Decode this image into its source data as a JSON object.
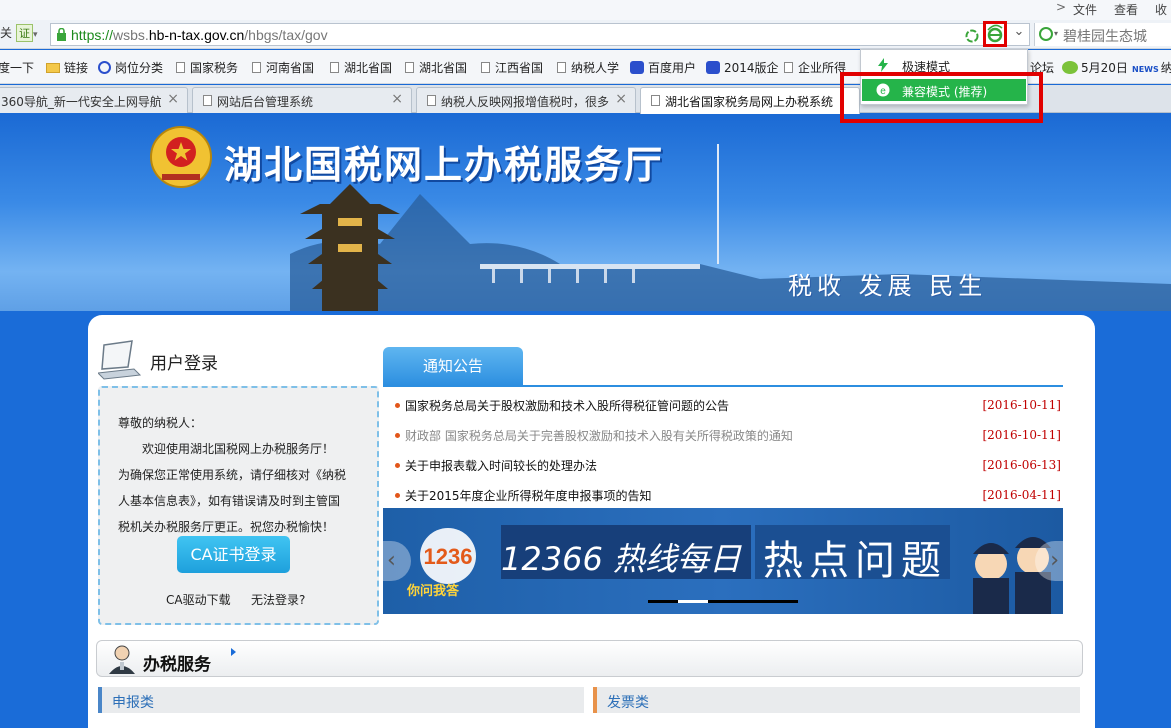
{
  "menubar": {
    "chevron": ">",
    "file": "文件",
    "view": "查看",
    "fav": "收藏"
  },
  "address": {
    "left_label": "关",
    "cert_label": "证",
    "url_proto": "https://",
    "url_pre": "wsbs.",
    "url_host": "hb-n-tax.gov.cn",
    "url_path": "/hbgs/tax/gov",
    "search_placeholder": "碧桂园生态城"
  },
  "bookmarks": [
    {
      "label": "度一下",
      "icon": "none"
    },
    {
      "label": "链接",
      "icon": "folder"
    },
    {
      "label": "岗位分类",
      "icon": "circle"
    },
    {
      "label": "国家税务",
      "icon": "page"
    },
    {
      "label": "河南省国",
      "icon": "page"
    },
    {
      "label": "湖北省国",
      "icon": "page"
    },
    {
      "label": "湖北省国",
      "icon": "page"
    },
    {
      "label": "江西省国",
      "icon": "page"
    },
    {
      "label": "纳税人学",
      "icon": "page"
    },
    {
      "label": "百度用户",
      "icon": "paw"
    },
    {
      "label": "2014版企",
      "icon": "paw"
    },
    {
      "label": "企业所得",
      "icon": "page"
    },
    {
      "label": "论坛",
      "icon": "none"
    },
    {
      "label": "5月20日",
      "icon": "bubble"
    },
    {
      "label": "纳税",
      "icon": "news"
    }
  ],
  "tabs": [
    {
      "label": "360导航_新一代安全上网导航",
      "close": "×"
    },
    {
      "label": "网站后台管理系统",
      "close": "×"
    },
    {
      "label": "纳税人反映网报增值税时，很多",
      "close": "×"
    },
    {
      "label": "湖北省国家税务局网上办税系统",
      "close": ""
    }
  ],
  "mode_menu": {
    "items": [
      {
        "label": "极速模式",
        "selected": false
      },
      {
        "label": "兼容模式 (推荐)",
        "selected": true
      }
    ]
  },
  "banner": {
    "title": "湖北国税网上办税服务厅",
    "slogan": "税收  发展  民生"
  },
  "login": {
    "title": "用户登录",
    "greeting": "尊敬的纳税人：",
    "welcome": "欢迎使用湖北国税网上办税服务厅！",
    "notice": "为确保您正常使用系统，请仔细核对《纳税人基本信息表》，如有错误请及时到主管国税机关办税服务厅更正。祝您办税愉快！",
    "ca_button": "CA证书登录",
    "driver_link": "CA驱动下载",
    "cannot_login_link": "无法登录?"
  },
  "notices": {
    "tab_label": "通知公告",
    "items": [
      {
        "title": "国家税务总局关于股权激励和技术入股所得税征管问题的公告",
        "date": "[2016-10-11]",
        "grey": false
      },
      {
        "title": "财政部 国家税务总局关于完善股权激励和技术入股有关所得税政策的通知",
        "date": "[2016-10-11]",
        "grey": true
      },
      {
        "title": "关于申报表载入时间较长的处理办法",
        "date": "[2016-06-13]",
        "grey": false
      },
      {
        "title": "关于2015年度企业所得税年度申报事项的告知",
        "date": "[2016-04-11]",
        "grey": false
      }
    ]
  },
  "hotline": {
    "text": "12366 热线每日",
    "highlight": "热点问题",
    "logo_caption": "你问我答",
    "prev": "‹",
    "next": "›"
  },
  "services": {
    "title": "办税服务",
    "categories": [
      {
        "label": "申报类",
        "color": "#4a86c8"
      },
      {
        "label": "发票类",
        "color": "#e8924a"
      }
    ]
  },
  "colors": {
    "accent": "#25b44a",
    "highlight_frame": "#e10000",
    "page_bg": "#1a6cd8",
    "date_red": "#c00000"
  }
}
